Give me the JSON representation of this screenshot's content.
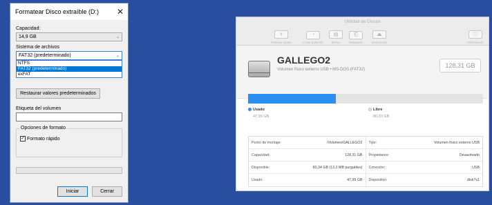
{
  "format_dialog": {
    "title": "Formatear Disco extraíble (D:)",
    "capacity_label": "Capacidad:",
    "capacity_value": "14,9 GB",
    "filesystem_label": "Sistema de archivos",
    "filesystem_value": "FAT32 (predeterminado)",
    "filesystem_options": [
      "NTFS",
      "FAT32 (predeterminado)",
      "exFAT"
    ],
    "restore_defaults": "Restaurar valores predeterminados",
    "volume_label": "Etiqueta del volumen",
    "volume_value": "",
    "format_options_label": "Opciones de formato",
    "quick_format_label": "Formato rápido",
    "quick_format_checked": true,
    "start_button": "Iniciar",
    "close_button": "Cerrar"
  },
  "disk_utility": {
    "window_title": "Utilidad de Discos",
    "toolbar": [
      {
        "icon": "first-aid-icon",
        "label": "Primera Ayuda"
      },
      {
        "icon": "partition-icon",
        "label": "Crear partición"
      },
      {
        "icon": "erase-icon",
        "label": "Borrar"
      },
      {
        "icon": "restore-icon",
        "label": "Restaurar"
      },
      {
        "icon": "unmount-icon",
        "label": "Desmontar"
      },
      {
        "icon": "info-icon",
        "label": "Información"
      }
    ],
    "volume_name": "GALLEGO2",
    "volume_subtitle": "Volumen físico externo USB • MS-DOS (FAT32)",
    "capacity_badge": "128,31 GB",
    "used_fraction": 0.374,
    "used_color": "#2a8ff0",
    "free_color": "#e4e4e4",
    "used_label": "Usado",
    "used_value": "47,99 GB",
    "free_label": "Libre",
    "free_value": "80,33 GB",
    "info_rows": [
      {
        "k1": "Punto de montaje:",
        "v1": "/Volumes/GALLEGO2",
        "k2": "Tipo:",
        "v2": "Volumen físico externo USB"
      },
      {
        "k1": "Capacidad:",
        "v1": "128,31 GB",
        "k2": "Propietarios:",
        "v2": "Desactivado"
      },
      {
        "k1": "Disponible:",
        "v1": "80,34 GB (12,2 MB purgables)",
        "k2": "Conexión:",
        "v2": "USB"
      },
      {
        "k1": "Usado:",
        "v1": "47,99 GB",
        "k2": "Dispositivo:",
        "v2": "disk7s1"
      }
    ]
  }
}
